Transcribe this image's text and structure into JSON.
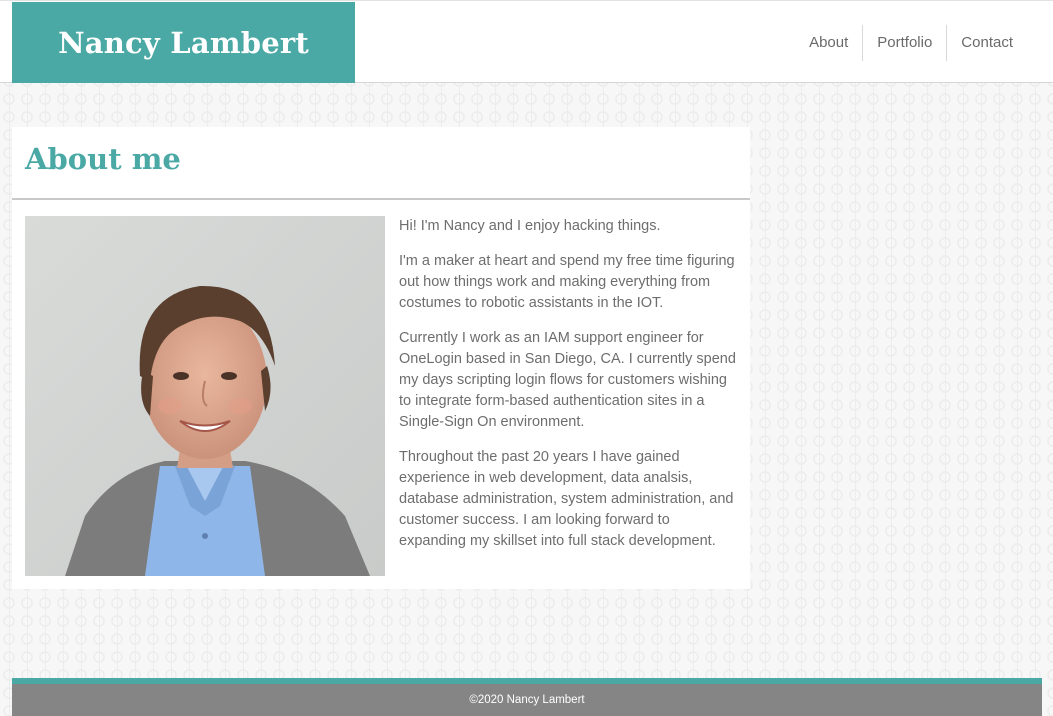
{
  "header": {
    "brand_name": "Nancy Lambert",
    "nav": [
      {
        "label": "About"
      },
      {
        "label": "Portfolio"
      },
      {
        "label": "Contact"
      }
    ]
  },
  "about": {
    "title": "About me",
    "paragraphs": [
      "Hi! I'm Nancy and I enjoy hacking things.",
      "I'm a maker at heart and spend my free time figuring out how things work and making everything from costumes to robotic assistants in the IOT.",
      "Currently I work as an IAM support engineer for OneLogin based in San Diego, CA. I currently spend my days scripting login flows for customers wishing to integrate form-based authentication sites in a Single-Sign On environment.",
      "Throughout the past 20 years I have gained experience in web development, data analsis, database administration, system administration, and customer success. I am looking forward to expanding my skillset into full stack development."
    ]
  },
  "footer": {
    "copyright": "©2020 Nancy Lambert"
  },
  "colors": {
    "accent": "#4aa8a5",
    "footer_bg": "#858585",
    "text": "#6d6d6d"
  }
}
